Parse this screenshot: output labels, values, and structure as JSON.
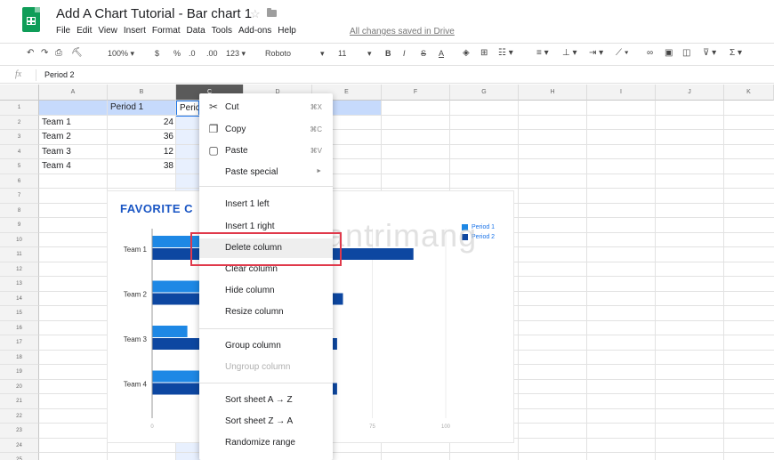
{
  "app": {
    "title": "Add A Chart Tutorial - Bar chart 1",
    "save_status": "All changes saved in Drive"
  },
  "menu_bar": [
    "File",
    "Edit",
    "View",
    "Insert",
    "Format",
    "Data",
    "Tools",
    "Add-ons",
    "Help"
  ],
  "toolbar": {
    "zoom": "100%",
    "currency": "$",
    "percent": "%",
    "decimal_decrease": ".0",
    "decimal_increase": ".00",
    "more_formats": "123",
    "font": "Roboto",
    "font_size": "11",
    "bold": "B",
    "italic": "I",
    "strikethrough": "S",
    "text_color": "A"
  },
  "formula_bar": {
    "fx": "fx",
    "value": "Period 2"
  },
  "columns": [
    "A",
    "B",
    "C",
    "D",
    "E",
    "F",
    "G",
    "H",
    "I",
    "J",
    "K"
  ],
  "rows": [
    "1",
    "2",
    "3",
    "4",
    "5",
    "6",
    "7",
    "8",
    "9",
    "10",
    "11",
    "12",
    "13",
    "14",
    "15",
    "16",
    "17",
    "18",
    "19",
    "20",
    "21",
    "22",
    "23",
    "24",
    "25"
  ],
  "cells": {
    "b1": "Period 1",
    "c1": "Peric",
    "a2": "Team 1",
    "b2": "24",
    "a3": "Team 2",
    "b3": "36",
    "a4": "Team 3",
    "b4": "12",
    "a5": "Team 4",
    "b5": "38"
  },
  "context_menu": {
    "cut": {
      "label": "Cut",
      "shortcut": "⌘X"
    },
    "copy": {
      "label": "Copy",
      "shortcut": "⌘C"
    },
    "paste": {
      "label": "Paste",
      "shortcut": "⌘V"
    },
    "paste_special": {
      "label": "Paste special",
      "arrow": "►"
    },
    "insert_left": "Insert 1 left",
    "insert_right": "Insert 1 right",
    "delete_column": "Delete column",
    "clear_column": "Clear column",
    "hide_column": "Hide column",
    "resize_column": "Resize column",
    "group_column": "Group column",
    "ungroup_column": "Ungroup column",
    "sort_az": "Sort sheet A → Z",
    "sort_za": "Sort sheet Z → A",
    "randomize": "Randomize range"
  },
  "chart_data": {
    "type": "bar",
    "orientation": "horizontal",
    "title": "FAVORITE C",
    "categories": [
      "Team 1",
      "Team 2",
      "Team 3",
      "Team 4"
    ],
    "series": [
      {
        "name": "Period 1",
        "values": [
          24,
          36,
          12,
          38
        ],
        "color": "#1e88e5"
      },
      {
        "name": "Period 2",
        "values": [
          89,
          65,
          63,
          63
        ],
        "color": "#0d47a1"
      }
    ],
    "x_ticks": [
      "0",
      "75",
      "100"
    ],
    "xlim": [
      0,
      100
    ],
    "grid": true,
    "legend_position": "top-right"
  },
  "watermark": "uantrimang",
  "colors": {
    "accent": "#1a73e8",
    "selected_header": "#5a5a5a",
    "highlight_box": "#e0394b"
  }
}
